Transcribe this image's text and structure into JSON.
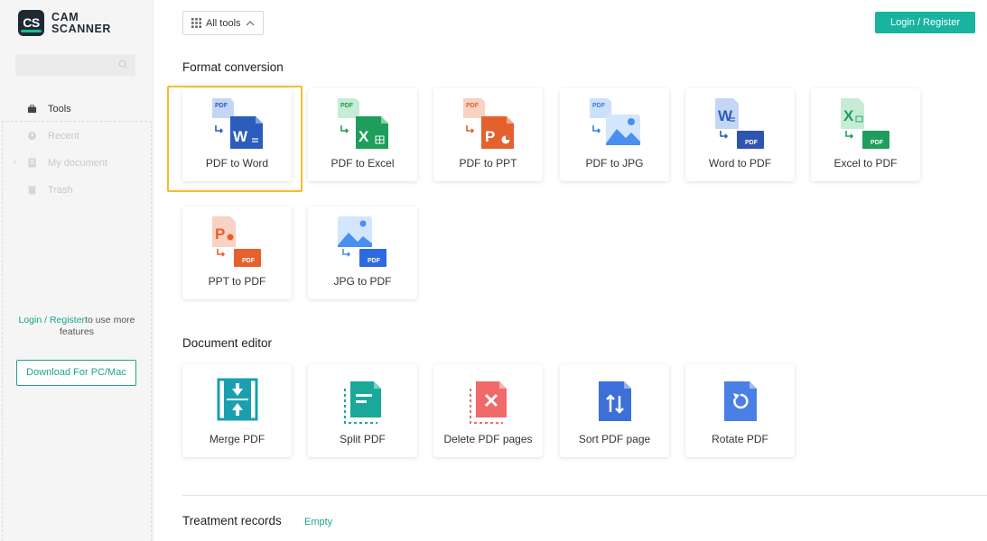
{
  "app": {
    "logo_badge": "CS",
    "logo_line1": "CAM",
    "logo_line2": "SCANNER",
    "brand_color": "#19b4a0"
  },
  "sidebar": {
    "search_placeholder": "",
    "items": [
      {
        "label": "Tools",
        "icon": "toolbox-icon",
        "active": true
      },
      {
        "label": "Recent",
        "icon": "clock-icon",
        "active": false
      },
      {
        "label": "My document",
        "icon": "document-icon",
        "active": false
      },
      {
        "label": "Trash",
        "icon": "trash-icon",
        "active": false
      }
    ],
    "promo_link": "Login / Register",
    "promo_text": "to use more features",
    "download_label": "Download For PC/Mac"
  },
  "topbar": {
    "all_tools_label": "All tools",
    "login_label": "Login / Register"
  },
  "format_conversion": {
    "title": "Format conversion",
    "tools": [
      {
        "label": "PDF to Word",
        "icon": "pdf-to-word-icon"
      },
      {
        "label": "PDF to Excel",
        "icon": "pdf-to-excel-icon"
      },
      {
        "label": "PDF to PPT",
        "icon": "pdf-to-ppt-icon"
      },
      {
        "label": "PDF to JPG",
        "icon": "pdf-to-jpg-icon"
      },
      {
        "label": "Word to PDF",
        "icon": "word-to-pdf-icon"
      },
      {
        "label": "Excel to PDF",
        "icon": "excel-to-pdf-icon"
      },
      {
        "label": "PPT to PDF",
        "icon": "ppt-to-pdf-icon"
      },
      {
        "label": "JPG to PDF",
        "icon": "jpg-to-pdf-icon"
      }
    ],
    "icon_text": {
      "pdf": "PDF",
      "word": "W",
      "excel": "X",
      "ppt": "P"
    }
  },
  "document_editor": {
    "title": "Document editor",
    "tools": [
      {
        "label": "Merge PDF",
        "icon": "merge-pdf-icon"
      },
      {
        "label": "Split PDF",
        "icon": "split-pdf-icon"
      },
      {
        "label": "Delete PDF pages",
        "icon": "delete-pages-icon"
      },
      {
        "label": "Sort PDF page",
        "icon": "sort-pages-icon"
      },
      {
        "label": "Rotate PDF",
        "icon": "rotate-pdf-icon"
      }
    ]
  },
  "records": {
    "title": "Treatment records",
    "status": "Empty"
  },
  "colors": {
    "word": "#2b5dbd",
    "excel": "#1e9e5a",
    "ppt": "#e4612e",
    "jpg": "#4a8ff0",
    "pdf_badge": "#2d6ae0",
    "highlight": "#f5bd2b"
  }
}
